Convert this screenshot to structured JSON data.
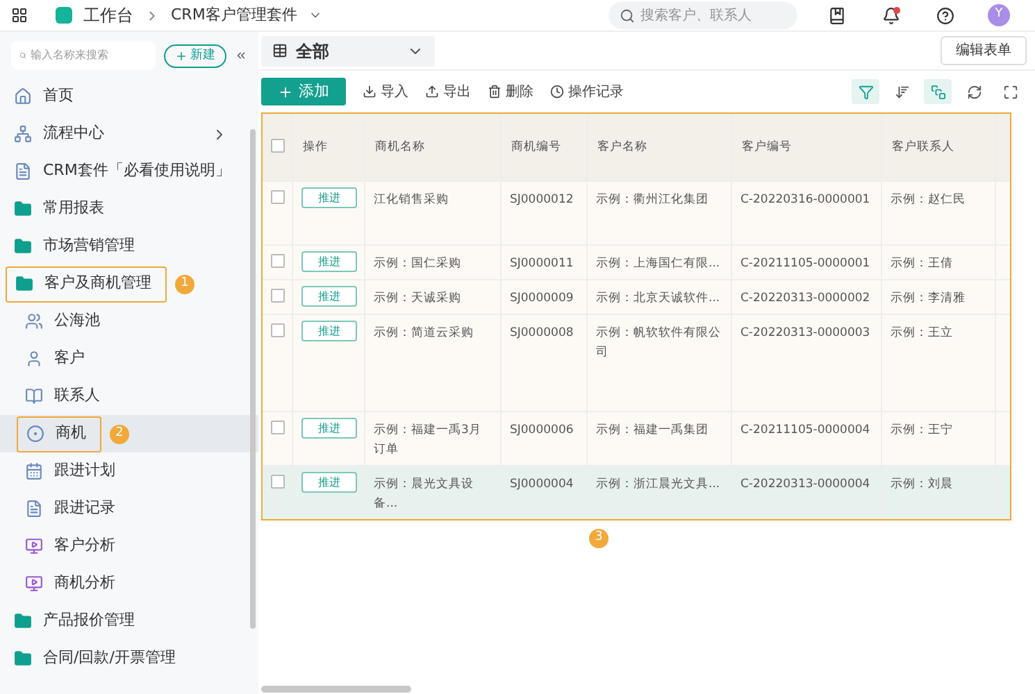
{
  "topbar": {
    "app": "工作台",
    "suite": "CRM客户管理套件",
    "search_placeholder": "搜索客户、联系人",
    "avatar": "Y",
    "notification": true
  },
  "sidebar": {
    "search_placeholder": "输入名称来搜索",
    "new_button": "新建",
    "items": [
      {
        "kind": "home",
        "label": "首页",
        "selected": false
      },
      {
        "kind": "flow",
        "label": "流程中心",
        "selected": false,
        "arrow": true
      },
      {
        "kind": "doc",
        "label": "CRM套件「必看使用说明」",
        "selected": false
      },
      {
        "kind": "folder",
        "label": "常用报表",
        "selected": false
      },
      {
        "kind": "folder",
        "label": "市场营销管理",
        "selected": false
      },
      {
        "kind": "folder",
        "label": "客户及商机管理",
        "selected": false,
        "annotation": "1",
        "children": [
          {
            "kind": "users",
            "label": "公海池",
            "selected": false
          },
          {
            "kind": "user",
            "label": "客户",
            "selected": false
          },
          {
            "kind": "book",
            "label": "联系人",
            "selected": false
          },
          {
            "kind": "target",
            "label": "商机",
            "selected": true,
            "annotation": "2"
          },
          {
            "kind": "calendar",
            "label": "跟进计划",
            "selected": false
          },
          {
            "kind": "doc",
            "label": "跟进记录",
            "selected": false
          },
          {
            "kind": "chart",
            "label": "客户分析",
            "selected": false
          },
          {
            "kind": "chart",
            "label": "商机分析",
            "selected": false
          }
        ]
      },
      {
        "kind": "folder",
        "label": "产品报价管理",
        "selected": false
      },
      {
        "kind": "folder",
        "label": "合同/回款/开票管理",
        "selected": false
      }
    ]
  },
  "view": {
    "name": "全部",
    "edit_button": "编辑表单"
  },
  "toolbar": {
    "add": "添加",
    "actions": [
      {
        "kind": "import",
        "label": "导入"
      },
      {
        "kind": "export",
        "label": "导出"
      },
      {
        "kind": "delete",
        "label": "删除"
      },
      {
        "kind": "log",
        "label": "操作记录"
      }
    ],
    "tools": [
      {
        "kind": "filter",
        "active": true
      },
      {
        "kind": "sort",
        "active": false
      },
      {
        "kind": "card",
        "active": true
      },
      {
        "kind": "refresh",
        "active": false
      },
      {
        "kind": "fullscreen",
        "active": false
      }
    ]
  },
  "table": {
    "annotation": "3",
    "all_checked": false,
    "columns": [
      "操作",
      "商机名称",
      "商机编号",
      "客户名称",
      "客户编号",
      "客户联系人"
    ],
    "rows": [
      {
        "checked": false,
        "selected": false,
        "cells": [
          "推进",
          "江化销售采购",
          "SJ0000012",
          "示例：衢州江化集团",
          "C-20220316-0000001",
          "示例：赵仁民"
        ]
      },
      {
        "checked": false,
        "selected": false,
        "cells": [
          "推进",
          "示例：国仁采购",
          "SJ0000011",
          "示例：上海国仁有限...",
          "C-20211105-0000001",
          "示例：王倩"
        ]
      },
      {
        "checked": false,
        "selected": false,
        "cells": [
          "推进",
          "示例：天诚采购",
          "SJ0000009",
          "示例：北京天诚软件...",
          "C-20220313-0000002",
          "示例：李清雅"
        ]
      },
      {
        "checked": false,
        "selected": false,
        "cells": [
          "推进",
          "示例：简道云采购",
          "SJ0000008",
          "示例：帆软软件有限公司",
          "C-20220313-0000003",
          "示例：王立"
        ]
      },
      {
        "checked": false,
        "selected": false,
        "cells": [
          "推进",
          "示例：福建一禹3月订单",
          "SJ0000006",
          "示例：福建一禹集团",
          "C-20211105-0000004",
          "示例：王宁"
        ]
      },
      {
        "checked": false,
        "selected": true,
        "cells": [
          "推进",
          "示例：晨光文具设备...",
          "SJ0000004",
          "示例：浙江晨光文具...",
          "C-20220313-0000004",
          "示例：刘晨"
        ]
      }
    ]
  }
}
